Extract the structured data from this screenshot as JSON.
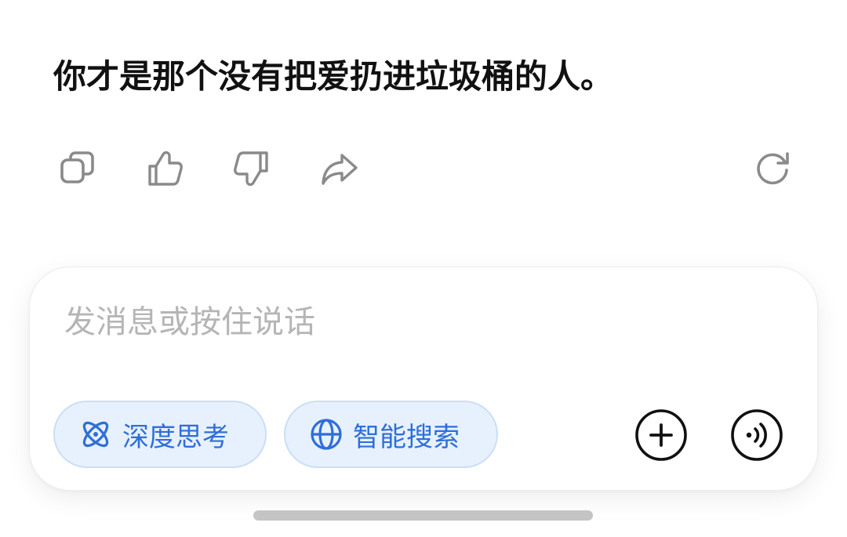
{
  "message": {
    "text": "你才是那个没有把爱扔进垃圾桶的人。"
  },
  "actions": {
    "copy_icon": "copy-icon",
    "like_icon": "thumbs-up-icon",
    "dislike_icon": "thumbs-down-icon",
    "share_icon": "share-icon",
    "regenerate_icon": "refresh-icon"
  },
  "composer": {
    "placeholder": "发消息或按住说话",
    "deep_think_label": "深度思考",
    "web_search_label": "智能搜索",
    "add_icon": "plus-circle-icon",
    "voice_icon": "voice-call-icon"
  },
  "colors": {
    "accent": "#2f6ed8",
    "chip_bg": "#e7f1fd",
    "chip_border": "#c9def9",
    "icon_gray": "#8a8a8a"
  }
}
